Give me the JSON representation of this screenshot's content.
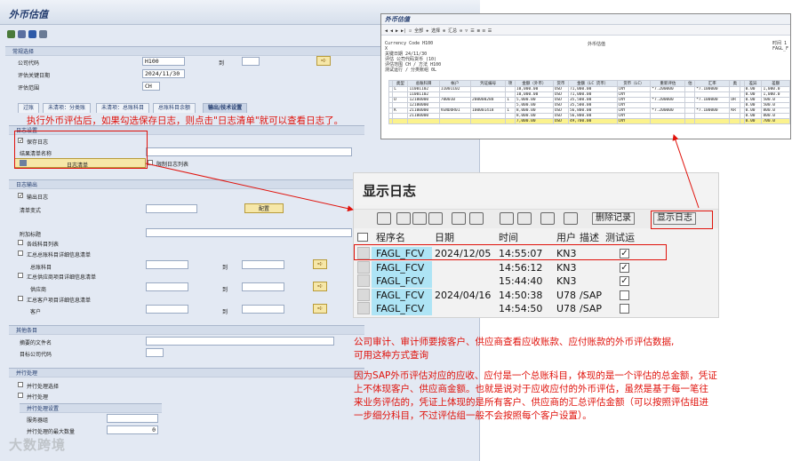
{
  "sap": {
    "title": "外币估值",
    "groups": {
      "general": "常规选择",
      "log_settings": "日志设置",
      "log_output": "日志输出",
      "other": "其他条目",
      "parallel": "并行处理"
    },
    "company_code_label": "公司代码",
    "company_code_value": "H100",
    "to_label": "到",
    "key_date_label": "评估关键日期",
    "key_date_value": "2024/11/30",
    "valuation_area_label": "评估范围",
    "valuation_area_value": "CH",
    "tabs": [
      "过账",
      "未清项：分类账",
      "未清项：总账科目",
      "总账科目余额",
      "输出/技术设置"
    ],
    "save_log_label": "保存日志",
    "save_log_checked": true,
    "result_list_name_label": "结果清单名称",
    "log_list_button": "日志清单",
    "limit_log_list_label": "限制日志列表",
    "output_log_label": "输出日志",
    "list_variant_label": "清单变式",
    "config_button": "配置",
    "additional_title_label": "附加标题",
    "item_list_label": "各线科目列表",
    "gl_detail_list_label": "汇总总账科目详细信息清单",
    "gl_account_label": "总账科目",
    "vendor_detail_list_label": "汇总供应商项目详细信息清单",
    "vendor_label": "供应商",
    "customer_detail_list_label": "汇总客户项目详细信息清单",
    "customer_label": "客户",
    "file_name_label": "摘要的文件名",
    "target_company_label": "目标公司代码",
    "parallel_select_label": "并行处理选择",
    "parallel_process_label": "并行处理",
    "parallel_settings_label": "并行处理设置",
    "server_group_label": "服务器组",
    "max_count_label": "并行处理的最大数量",
    "max_count_value": "0"
  },
  "annotation_top": "执行外币评估后，如果勾选保存日志，则点击\"日志清单\"就可以查看日志了。",
  "report": {
    "title": "外币估值",
    "toolbar_text": "◀ ◀ ▶ ▶|  ☑ 全部  ✚ 选择  ⊕ 汇总  ⊖  ▽  ☰  ⊞  ⊡  ☰",
    "header_left": [
      "Currency Code  H100",
      "X",
      "关键日期 24/11/30",
      "评估 公司代码货币 (10)",
      "评估范围 CH / 方法 H100",
      "测试运行 / 分类账组 0L"
    ],
    "header_center": "外币估值",
    "header_right": [
      "时间 1",
      "FAGL_F"
    ],
    "columns": [
      "",
      "类型",
      "总账科目",
      "帐户",
      "凭证编号",
      "项",
      "金额（外币）",
      "货币",
      "金额（LC 货币）",
      "货币（LC）",
      "重新评估",
      "估",
      "汇率",
      "类",
      "",
      "差异",
      "差额"
    ],
    "rows": [
      [
        "",
        "L",
        "11001102",
        "11001102",
        "",
        "",
        "10,000.00",
        "USD",
        "71,000.00",
        "CNY",
        "*7.200000",
        "",
        "*7.100000",
        "",
        "",
        "0.00",
        "1,000.0"
      ],
      [
        "",
        "",
        "11001102",
        "",
        "",
        "",
        "10,000.00",
        "USD",
        "71,000.00",
        "CNY",
        "",
        "",
        "",
        "",
        "",
        "0.00",
        "1,000.0"
      ],
      [
        "",
        "D",
        "12100000",
        "700010",
        "200000288",
        "1",
        "5,000.00",
        "USD",
        "35,500.00",
        "CNY",
        "*7.200000",
        "",
        "*7.100000",
        "DR",
        "",
        "0.00",
        "500.0"
      ],
      [
        "",
        "",
        "12100000",
        "",
        "",
        "",
        "5,000.00",
        "USD",
        "35,500.00",
        "CNY",
        "",
        "",
        "",
        "",
        "",
        "0.00",
        "500.0"
      ],
      [
        "",
        "K",
        "21100000",
        "VENDOR01",
        "100001418",
        "1",
        "8,000.00",
        "USD",
        "56,800.00",
        "CNY",
        "*7.200000",
        "",
        "*7.100000",
        "KR",
        "",
        "0.00",
        "800.0"
      ],
      [
        "",
        "",
        "21100000",
        "",
        "",
        "",
        "8,000.00",
        "USD",
        "56,800.00",
        "CNY",
        "",
        "",
        "",
        "",
        "",
        "0.00",
        "800.0"
      ]
    ],
    "total_row": [
      "",
      "",
      "",
      "",
      "",
      "",
      "7,000.00",
      "USD",
      "49,700.00",
      "CNY",
      "",
      "",
      "",
      "",
      "",
      "0.00",
      "700.0"
    ]
  },
  "log": {
    "title": "显示日志",
    "delete_button": "删除记录",
    "show_log_button": "显示日志",
    "columns": [
      "程序名",
      "日期",
      "时间",
      "用户",
      "描述",
      "测试运"
    ],
    "rows": [
      {
        "program": "FAGL_FCV",
        "date": "2024/12/05",
        "time": "14:55:07",
        "user": "KN3",
        "desc": "",
        "test": true
      },
      {
        "program": "FAGL_FCV",
        "date": "",
        "time": "14:56:12",
        "user": "KN3",
        "desc": "",
        "test": true
      },
      {
        "program": "FAGL_FCV",
        "date": "",
        "time": "15:44:40",
        "user": "KN3",
        "desc": "",
        "test": true
      },
      {
        "program": "FAGL_FCV",
        "date": "2024/04/16",
        "time": "14:50:38",
        "user": "U78",
        "desc": "/SAP",
        "test": false
      },
      {
        "program": "FAGL_FCV",
        "date": "",
        "time": "14:54:50",
        "user": "U78",
        "desc": "/SAP",
        "test": false
      }
    ]
  },
  "note1": [
    "公司审计、审计师要按客户、供应商查看应收账款、应付账款的外币评估数据,",
    "可用这种方式查询"
  ],
  "note2": [
    "因为SAP外币评估对应的应收、应付是一个总账科目，体现的是一个评估的总金额，凭证",
    "上不体现客户、供应商金额。也就是说对于应收应付的外币评估，虽然是基于每一笔往",
    "来业务评估的，凭证上体现的是所有客户、供应商的汇总评估金额（可以按照评估组进",
    "一步细分科目，不过评估组一般不会按照每个客户设置）。"
  ],
  "watermark": "大数跨境",
  "colors": {
    "annotation": "#e0120b",
    "sap_bg": "#e3e9f3",
    "highlight_row": "#fbf28d",
    "log_cell": "#aee4f5"
  }
}
